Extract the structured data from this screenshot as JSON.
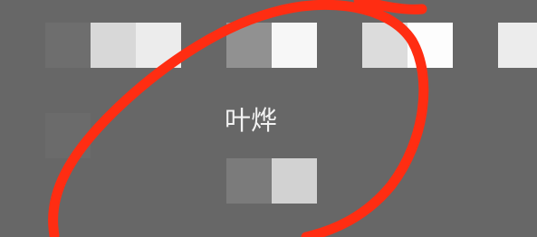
{
  "center_label": "叶烨",
  "colors": {
    "background": "#676767",
    "annotation_stroke": "#ff2d12"
  },
  "tiles": {
    "row1": {
      "a1": "#6e6e6e",
      "a2": "#d8d8d8",
      "a3": "#ececec",
      "b1": "#919191",
      "b2": "#f7f7f7",
      "c1": "#dcdcdc",
      "c2": "#fdfdfd",
      "d1": "#ececec"
    },
    "row2": {
      "left": "#6b6b6b"
    },
    "row3": {
      "b1": "#7b7b7b",
      "b2": "#d2d2d2"
    }
  },
  "annotation": {
    "type": "hand-drawn-loop",
    "color": "#ff2d12"
  }
}
